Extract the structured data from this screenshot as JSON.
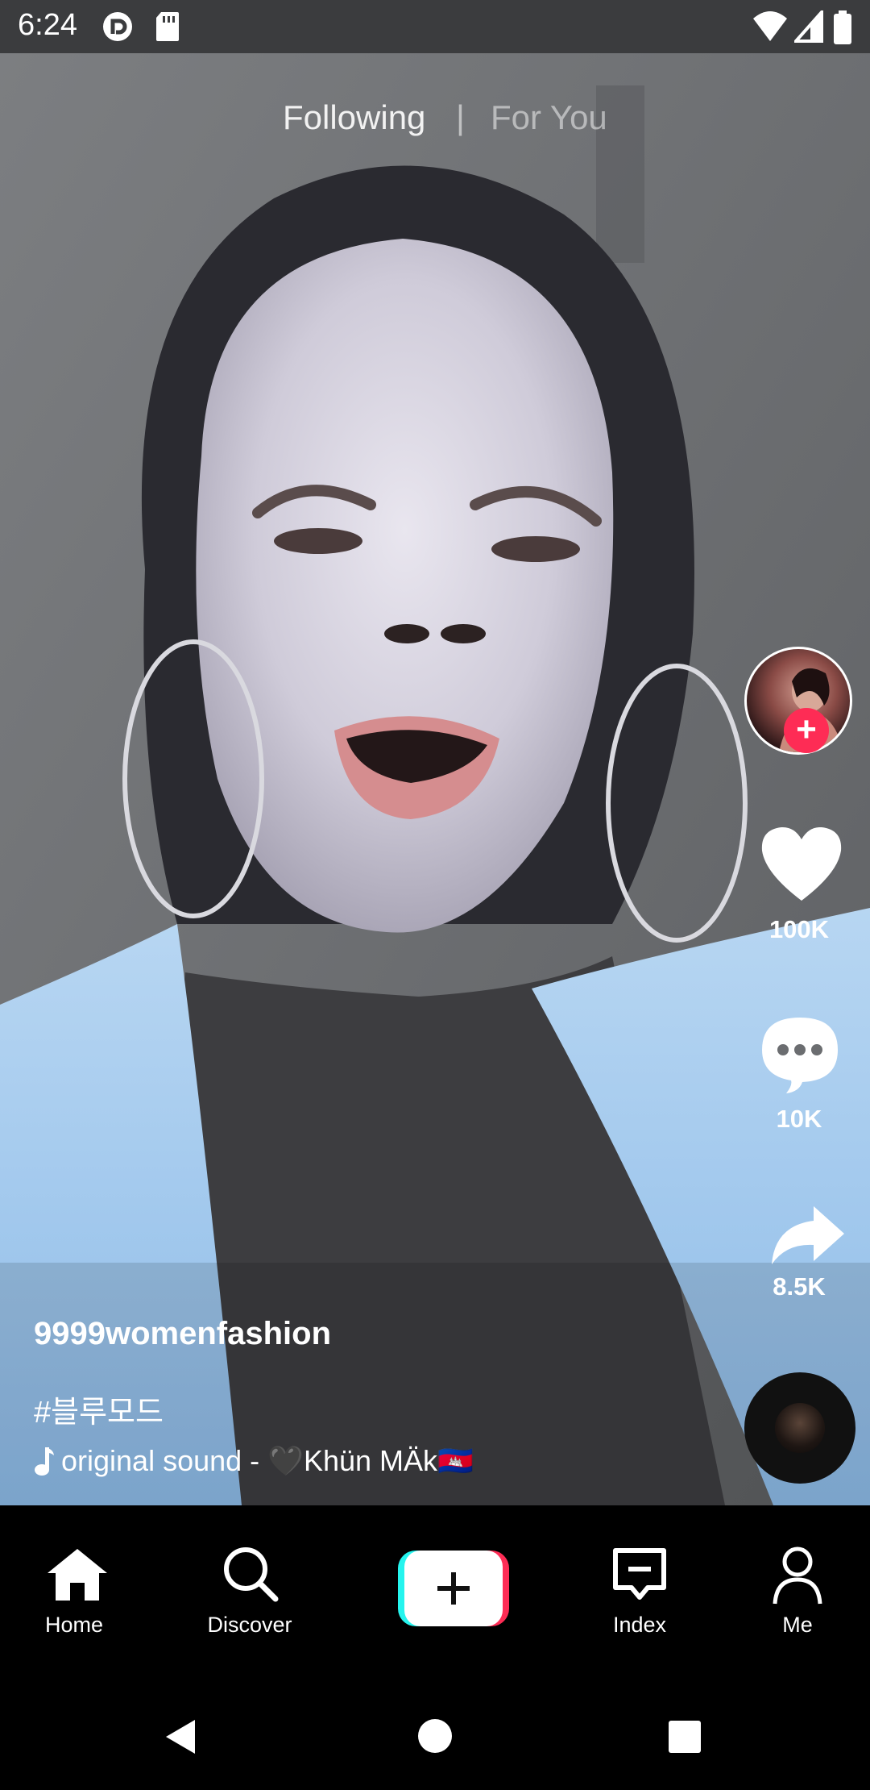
{
  "status_bar": {
    "time": "6:24",
    "left_icons": [
      "pocket-casts-icon",
      "sd-card-icon"
    ],
    "right_icons": [
      "wifi-icon",
      "cell-signal-icon",
      "battery-icon"
    ]
  },
  "feed_tabs": {
    "following": "Following",
    "divider": "|",
    "for_you": "For You",
    "active": "Following"
  },
  "actions": {
    "like_count": "100K",
    "comment_count": "10K",
    "share_count": "8.5K"
  },
  "caption": {
    "username": "9999womenfashion",
    "hashtag": "#블루모드",
    "sound": "original sound - 🖤Khün MÄk🇰🇭"
  },
  "bottom_nav": {
    "items": [
      {
        "label": "Home",
        "icon": "home-icon"
      },
      {
        "label": "Discover",
        "icon": "search-icon"
      },
      {
        "label": "",
        "icon": "plus-icon"
      },
      {
        "label": "Index",
        "icon": "inbox-icon"
      },
      {
        "label": "Me",
        "icon": "profile-icon"
      }
    ],
    "active": "Home"
  },
  "colors": {
    "accent_red": "#fe2c55",
    "accent_cyan": "#25f4ee",
    "status_bar_bg": "#3b3c3e"
  }
}
